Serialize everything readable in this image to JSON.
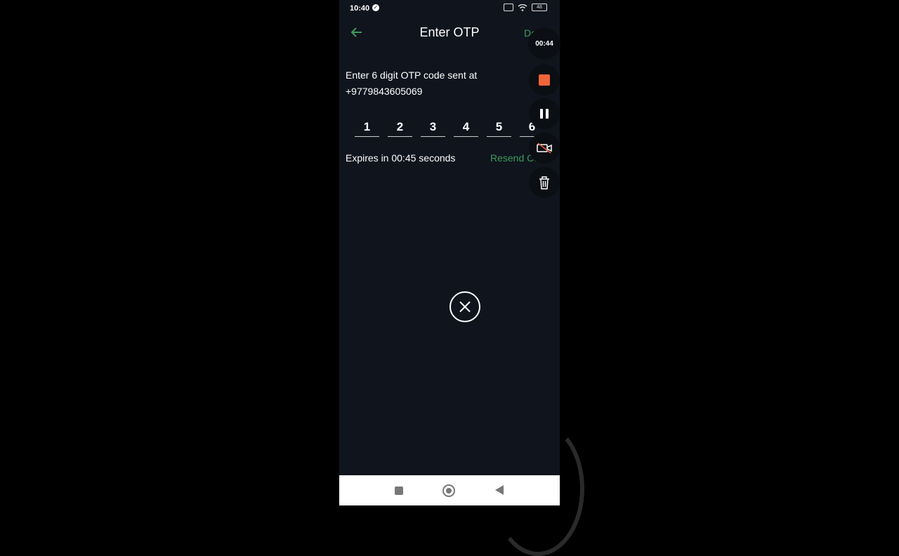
{
  "status_bar": {
    "time": "10:40",
    "battery": "48"
  },
  "header": {
    "title": "Enter OTP",
    "done_label": "Done"
  },
  "instruction": {
    "line1": "Enter 6 digit OTP code sent at",
    "phone": "+9779843605069"
  },
  "otp_digits": [
    "1",
    "2",
    "3",
    "4",
    "5",
    "6"
  ],
  "expiry_text": "Expires in 00:45 seconds",
  "resend_label": "Resend Code",
  "recorder": {
    "timer": "00:44",
    "stop_color": "#f0643a"
  },
  "colors": {
    "accent": "#3d9a5c",
    "background": "#0f141d"
  },
  "icons": [
    "back-arrow-icon",
    "stop-icon",
    "pause-icon",
    "camera-off-icon",
    "trash-icon",
    "close-icon",
    "nav-recents-icon",
    "nav-home-icon",
    "nav-back-icon"
  ]
}
